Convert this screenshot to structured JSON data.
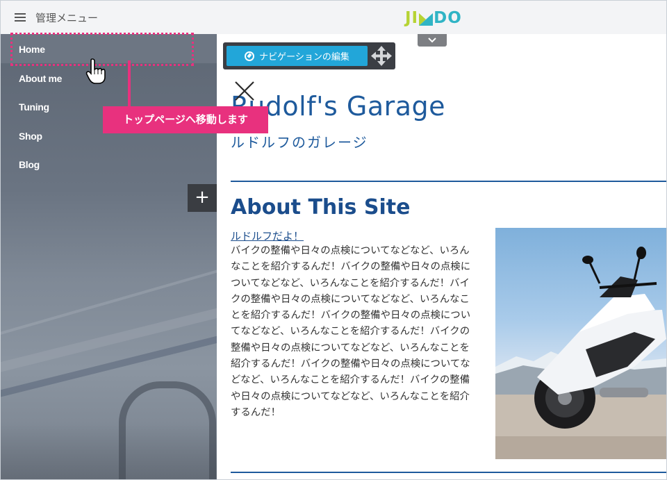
{
  "admin_bar": {
    "menu_label": "管理メニュー",
    "logo_text": "JIMDO",
    "collapse_icon": "chevron-down-icon"
  },
  "sidebar": {
    "items": [
      {
        "label": "Home",
        "active": true
      },
      {
        "label": "About me"
      },
      {
        "label": "Tuning"
      },
      {
        "label": "Shop"
      },
      {
        "label": "Blog"
      }
    ],
    "add_icon": "plus-icon"
  },
  "tooltip": {
    "text": "トップページへ移動します"
  },
  "nav_toolbar": {
    "edit_label": "ナビゲーションの編集",
    "edit_icon": "compass-icon",
    "move_icon": "move-icon"
  },
  "site": {
    "title": "Rudolf's Garage",
    "subtitle": "ルドルフのガレージ"
  },
  "article": {
    "heading": "About This Site",
    "link_text": "ルドルフだよ！",
    "body": "バイクの整備や日々の点検についてなどなど、いろんなことを紹介するんだ！バイクの整備や日々の点検についてなどなど、いろんなことを紹介するんだ！バイクの整備や日々の点検についてなどなど、いろんなことを紹介するんだ！バイクの整備や日々の点検についてなどなど、いろんなことを紹介するんだ！バイクの整備や日々の点検についてなどなど、いろんなことを紹介するんだ！バイクの整備や日々の点検についてなどなど、いろんなことを紹介するんだ！バイクの整備や日々の点検についてなどなど、いろんなことを紹介するんだ！"
  },
  "colors": {
    "accent_pink": "#e8317e",
    "nav_button_blue": "#22a6d9",
    "title_blue": "#1e5a9c",
    "logo_green": "#b6d334",
    "logo_teal": "#30b4c5"
  }
}
